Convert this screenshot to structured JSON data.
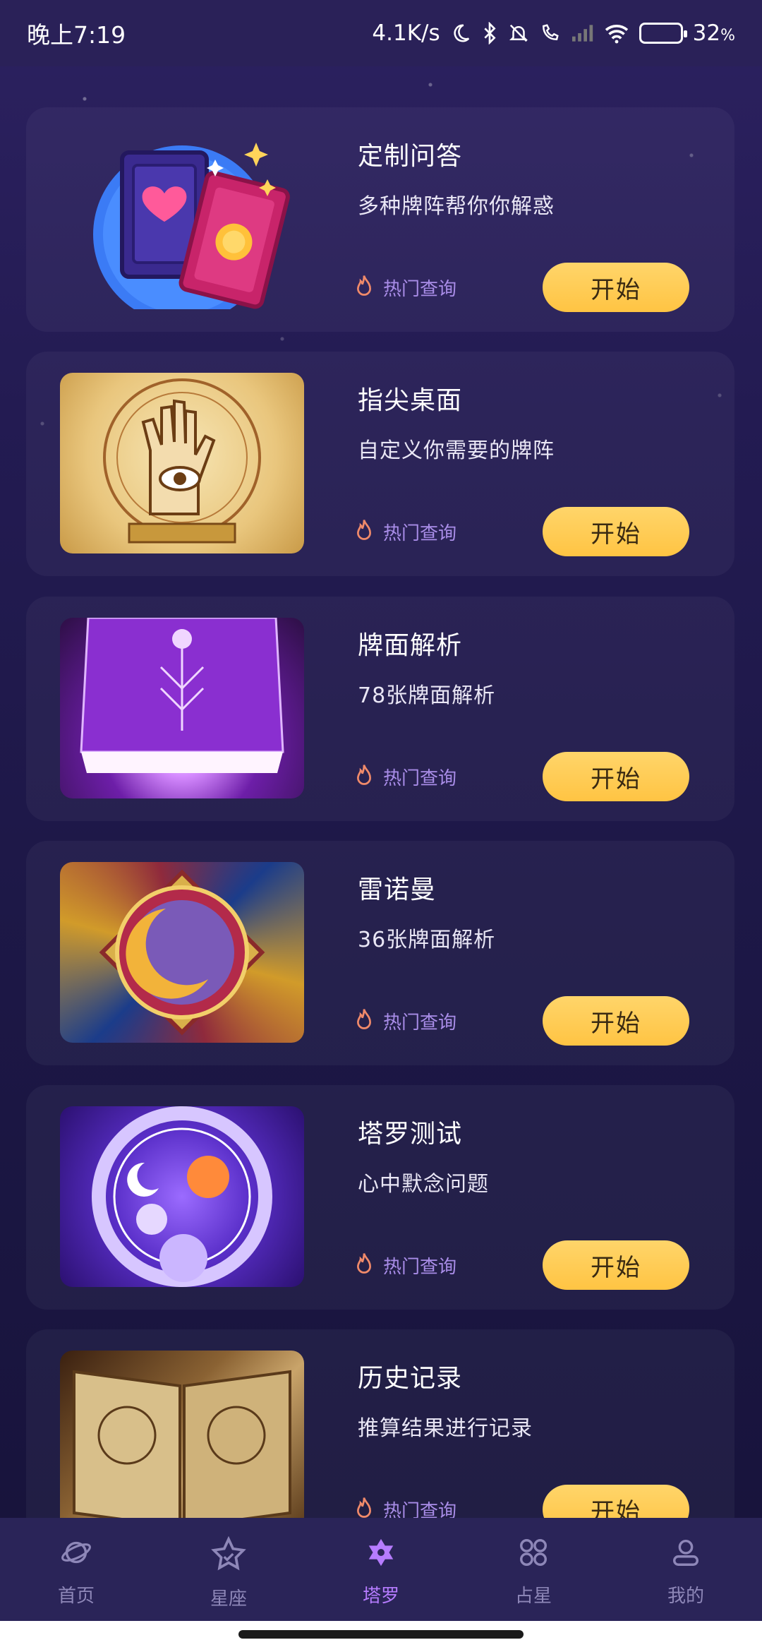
{
  "status_bar": {
    "time": "晚上7:19",
    "speed": "4.1K/s",
    "battery_percent": "32",
    "battery_sign": "%"
  },
  "cards": [
    {
      "title": "定制问答",
      "subtitle": "多种牌阵帮你你解惑",
      "hot_label": "热门查询",
      "button_label": "开始"
    },
    {
      "title": "指尖桌面",
      "subtitle": "自定义你需要的牌阵",
      "hot_label": "热门查询",
      "button_label": "开始"
    },
    {
      "title": "牌面解析",
      "subtitle": "78张牌面解析",
      "hot_label": "热门查询",
      "button_label": "开始"
    },
    {
      "title": "雷诺曼",
      "subtitle": "36张牌面解析",
      "hot_label": "热门查询",
      "button_label": "开始"
    },
    {
      "title": "塔罗测试",
      "subtitle": "心中默念问题",
      "hot_label": "热门查询",
      "button_label": "开始"
    },
    {
      "title": "历史记录",
      "subtitle": "推算结果进行记录",
      "hot_label": "热门查询",
      "button_label": "开始"
    }
  ],
  "bottom_nav": [
    {
      "label": "首页",
      "icon": "planet-icon",
      "active": false
    },
    {
      "label": "星座",
      "icon": "star-icon",
      "active": false
    },
    {
      "label": "塔罗",
      "icon": "tarot-star-icon",
      "active": true
    },
    {
      "label": "占星",
      "icon": "four-circles-icon",
      "active": false
    },
    {
      "label": "我的",
      "icon": "profile-icon",
      "active": false
    }
  ],
  "colors": {
    "accent_yellow": "#ffc443",
    "active_tab": "#b67cff",
    "hot_label": "#a98de8",
    "flame": "#f08a6a"
  }
}
